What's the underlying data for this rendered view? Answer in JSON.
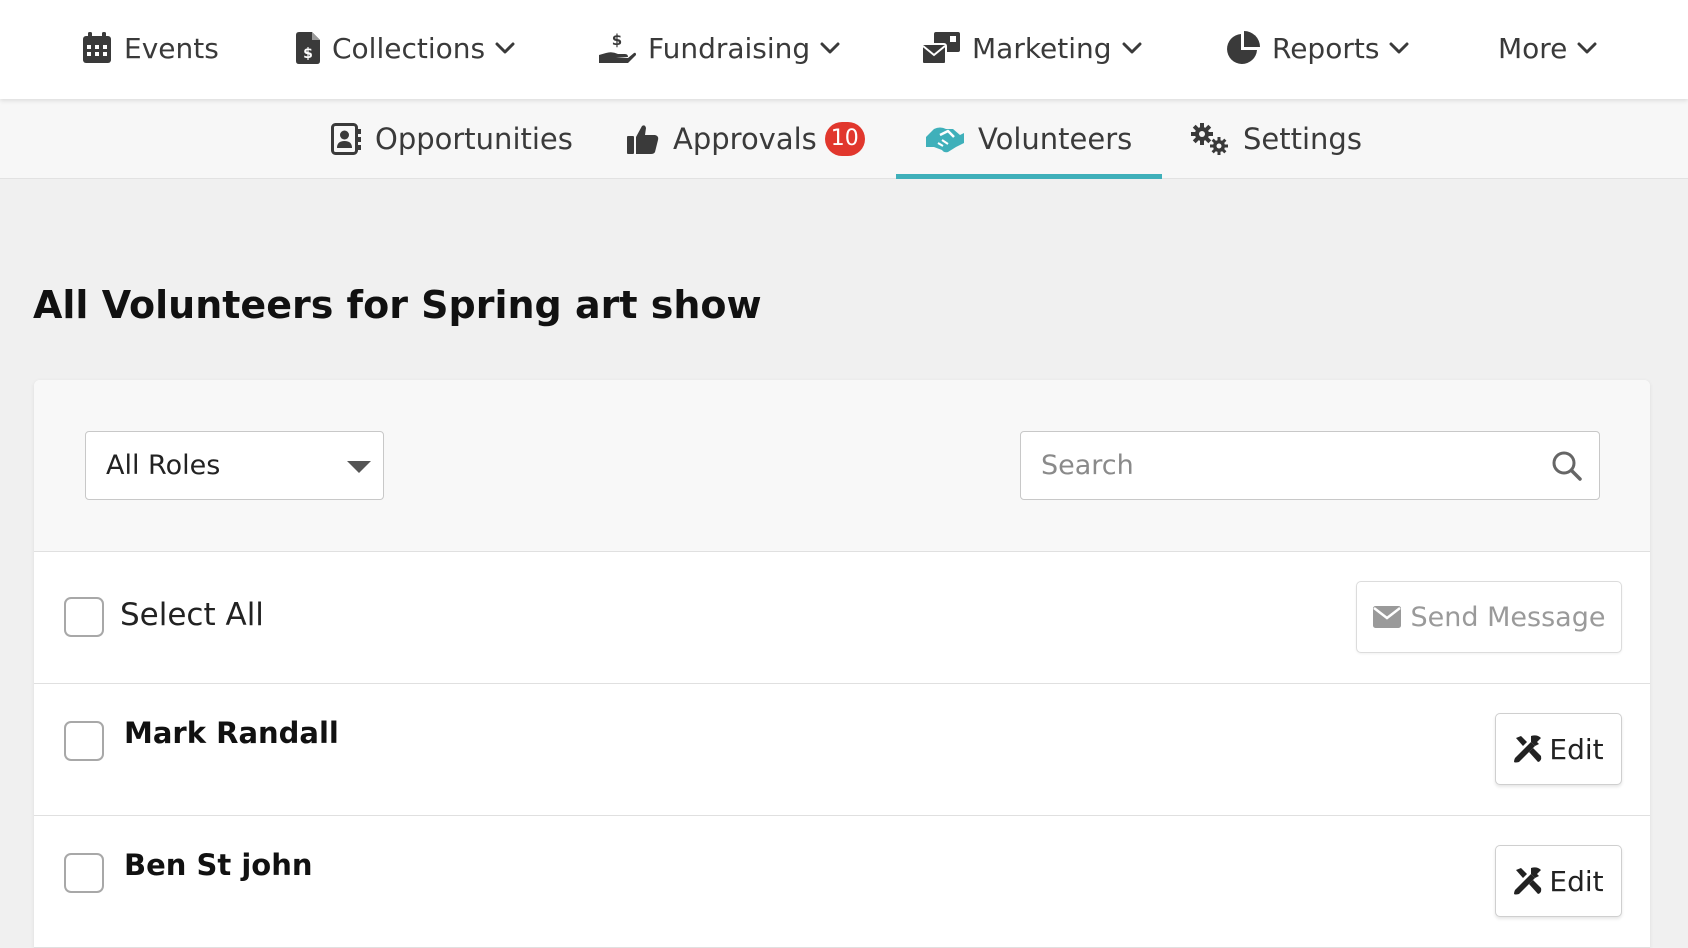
{
  "topnav": {
    "items": [
      {
        "label": "Events",
        "icon": "calendar-icon",
        "has_dropdown": false
      },
      {
        "label": "Collections",
        "icon": "invoice-dollar-icon",
        "has_dropdown": true
      },
      {
        "label": "Fundraising",
        "icon": "hand-holding-dollar-icon",
        "has_dropdown": true
      },
      {
        "label": "Marketing",
        "icon": "mail-bulk-icon",
        "has_dropdown": true
      },
      {
        "label": "Reports",
        "icon": "pie-chart-icon",
        "has_dropdown": true
      },
      {
        "label": "More",
        "icon": null,
        "has_dropdown": true
      }
    ]
  },
  "subnav": {
    "items": [
      {
        "label": "Opportunities",
        "icon": "address-card-icon"
      },
      {
        "label": "Approvals",
        "icon": "thumbs-up-icon",
        "badge": "10"
      },
      {
        "label": "Volunteers",
        "icon": "handshake-icon",
        "active": true
      },
      {
        "label": "Settings",
        "icon": "gears-icon"
      }
    ]
  },
  "page": {
    "title": "All Volunteers for Spring art show"
  },
  "filters": {
    "role_select": {
      "value": "All Roles"
    },
    "search": {
      "placeholder": "Search",
      "value": ""
    }
  },
  "list": {
    "select_all_label": "Select All",
    "send_message_label": "Send Message",
    "edit_label": "Edit",
    "volunteers": [
      {
        "name": "Mark Randall"
      },
      {
        "name": "Ben St john"
      }
    ]
  },
  "colors": {
    "accent": "#3fb0ba",
    "badge": "#e1372d",
    "nav_text": "#3a3a3a"
  }
}
